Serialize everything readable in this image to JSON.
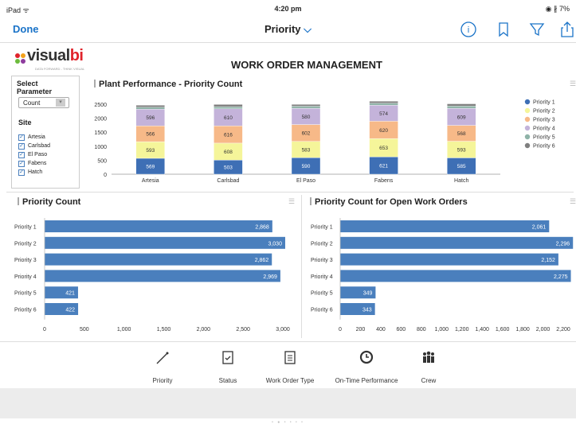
{
  "status": {
    "left": "iPad ᯤ",
    "time": "4:20 pm",
    "right": "◉ ∦ 7%"
  },
  "nav": {
    "done": "Done",
    "title": "Priority"
  },
  "logo": {
    "main": "visual",
    "accent": "bi",
    "tagline": "DATA FORWARD - THINK VISUAL"
  },
  "app_title": "WORK ORDER MANAGEMENT",
  "params": {
    "title": "Select Parameter",
    "select_value": "Count",
    "site_label": "Site",
    "sites": [
      "Artesia",
      "Carlsbad",
      "El Paso",
      "Fabens",
      "Hatch"
    ]
  },
  "colors": {
    "p1": "#3e6fb5",
    "p2": "#f5f59a",
    "p3": "#f7b988",
    "p4": "#c4b3da",
    "p5": "#8fb3a8",
    "p6": "#7f7f7f",
    "bar": "#4a7fbd"
  },
  "chart_data": [
    {
      "type": "bar",
      "title": "Plant Performance - Priority Count",
      "stacked": true,
      "categories": [
        "Artesia",
        "Carlsbad",
        "El Paso",
        "Fabens",
        "Hatch"
      ],
      "series": [
        {
          "name": "Priority 1",
          "values": [
            569,
            503,
            590,
            621,
            585
          ]
        },
        {
          "name": "Priority 2",
          "values": [
            593,
            608,
            583,
            653,
            593
          ]
        },
        {
          "name": "Priority 3",
          "values": [
            566,
            616,
            602,
            620,
            568
          ]
        },
        {
          "name": "Priority 4",
          "values": [
            596,
            610,
            580,
            574,
            609
          ]
        },
        {
          "name": "Priority 5",
          "values": [
            70,
            75,
            75,
            70,
            80
          ]
        },
        {
          "name": "Priority 6",
          "values": [
            70,
            80,
            65,
            70,
            80
          ]
        }
      ],
      "yticks": [
        "0",
        "500",
        "1000",
        "1500",
        "2000",
        "2500"
      ],
      "ylim": [
        0,
        2700
      ],
      "legend": "right"
    },
    {
      "type": "bar",
      "orientation": "horizontal",
      "title": "Priority Count",
      "categories": [
        "Priority 1",
        "Priority 2",
        "Priority 3",
        "Priority 4",
        "Priority 5",
        "Priority 6"
      ],
      "values": [
        2868,
        3030,
        2862,
        2969,
        421,
        422
      ],
      "labels": [
        "2,868",
        "3,030",
        "2,862",
        "2,969",
        "421",
        "422"
      ],
      "xticks": [
        "0",
        "500",
        "1,000",
        "1,500",
        "2,000",
        "2,500",
        "3,000"
      ],
      "xlim": [
        0,
        3000
      ]
    },
    {
      "type": "bar",
      "orientation": "horizontal",
      "title": "Priority Count for Open Work Orders",
      "categories": [
        "Priority 1",
        "Priority 2",
        "Priority 3",
        "Priority 4",
        "Priority 5",
        "Priority 6"
      ],
      "values": [
        2061,
        2296,
        2152,
        2275,
        349,
        343
      ],
      "labels": [
        "2,061",
        "2,296",
        "2,152",
        "2,275",
        "349",
        "343"
      ],
      "xticks": [
        "0",
        "200",
        "400",
        "600",
        "800",
        "1,000",
        "1,200",
        "1,400",
        "1,600",
        "1,800",
        "2,000",
        "2,200"
      ],
      "xlim": [
        0,
        2200
      ]
    }
  ],
  "tabs": [
    {
      "label": "Priority",
      "icon": "pin-icon"
    },
    {
      "label": "Status",
      "icon": "clipboard-check-icon"
    },
    {
      "label": "Work Order Type",
      "icon": "clipboard-list-icon"
    },
    {
      "label": "On-Time Performance",
      "icon": "clock-icon"
    },
    {
      "label": "Crew",
      "icon": "people-icon"
    }
  ],
  "page_dots": "• ● • • • •"
}
